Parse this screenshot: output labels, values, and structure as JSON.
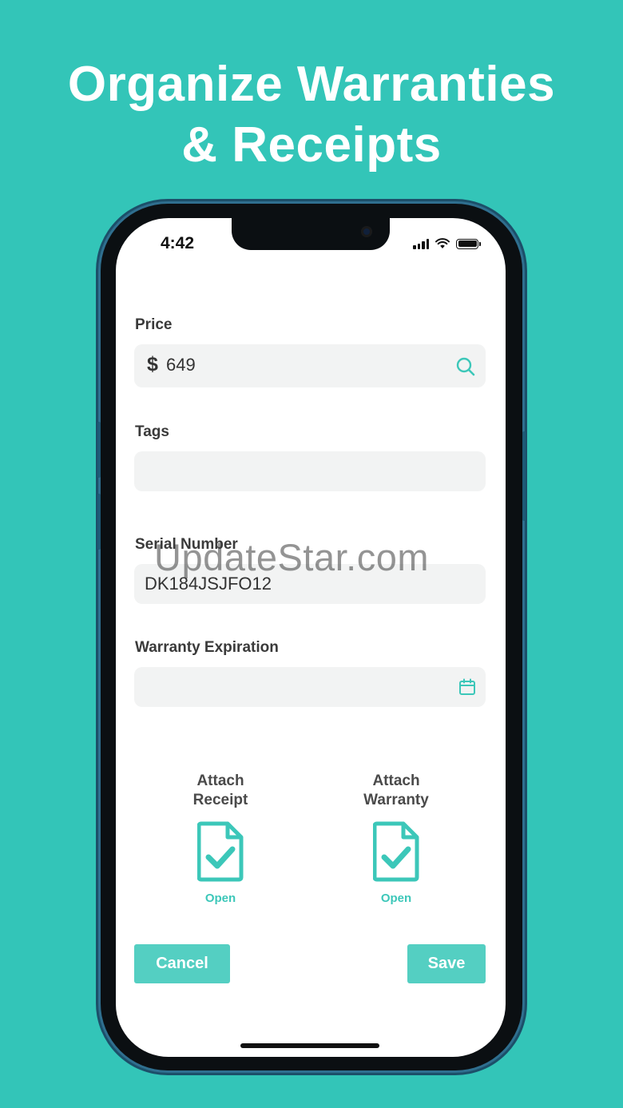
{
  "headline": {
    "line1": "Organize Warranties",
    "line2": "& Receipts"
  },
  "status_bar": {
    "time": "4:42",
    "signal_icon": "cellular-signal-icon",
    "wifi_icon": "wifi-icon",
    "battery_icon": "battery-icon"
  },
  "form": {
    "price": {
      "label": "Price",
      "currency_symbol": "$",
      "value": "649",
      "action_icon": "search-icon"
    },
    "tags": {
      "label": "Tags",
      "value": ""
    },
    "serial": {
      "label": "Serial Number",
      "value": "DK184JSJFO12"
    },
    "warranty_expiration": {
      "label": "Warranty Expiration",
      "value": "",
      "action_icon": "calendar-icon"
    }
  },
  "attachments": {
    "receipt": {
      "title_line1": "Attach",
      "title_line2": "Receipt",
      "icon": "document-check-icon",
      "link": "Open"
    },
    "warranty": {
      "title_line1": "Attach",
      "title_line2": "Warranty",
      "icon": "document-check-icon",
      "link": "Open"
    }
  },
  "actions": {
    "cancel_label": "Cancel",
    "save_label": "Save"
  },
  "watermark": "UpdateStar.com",
  "colors": {
    "background": "#33c5b8",
    "accent": "#54cfc2",
    "icon": "#3cc7b9"
  }
}
